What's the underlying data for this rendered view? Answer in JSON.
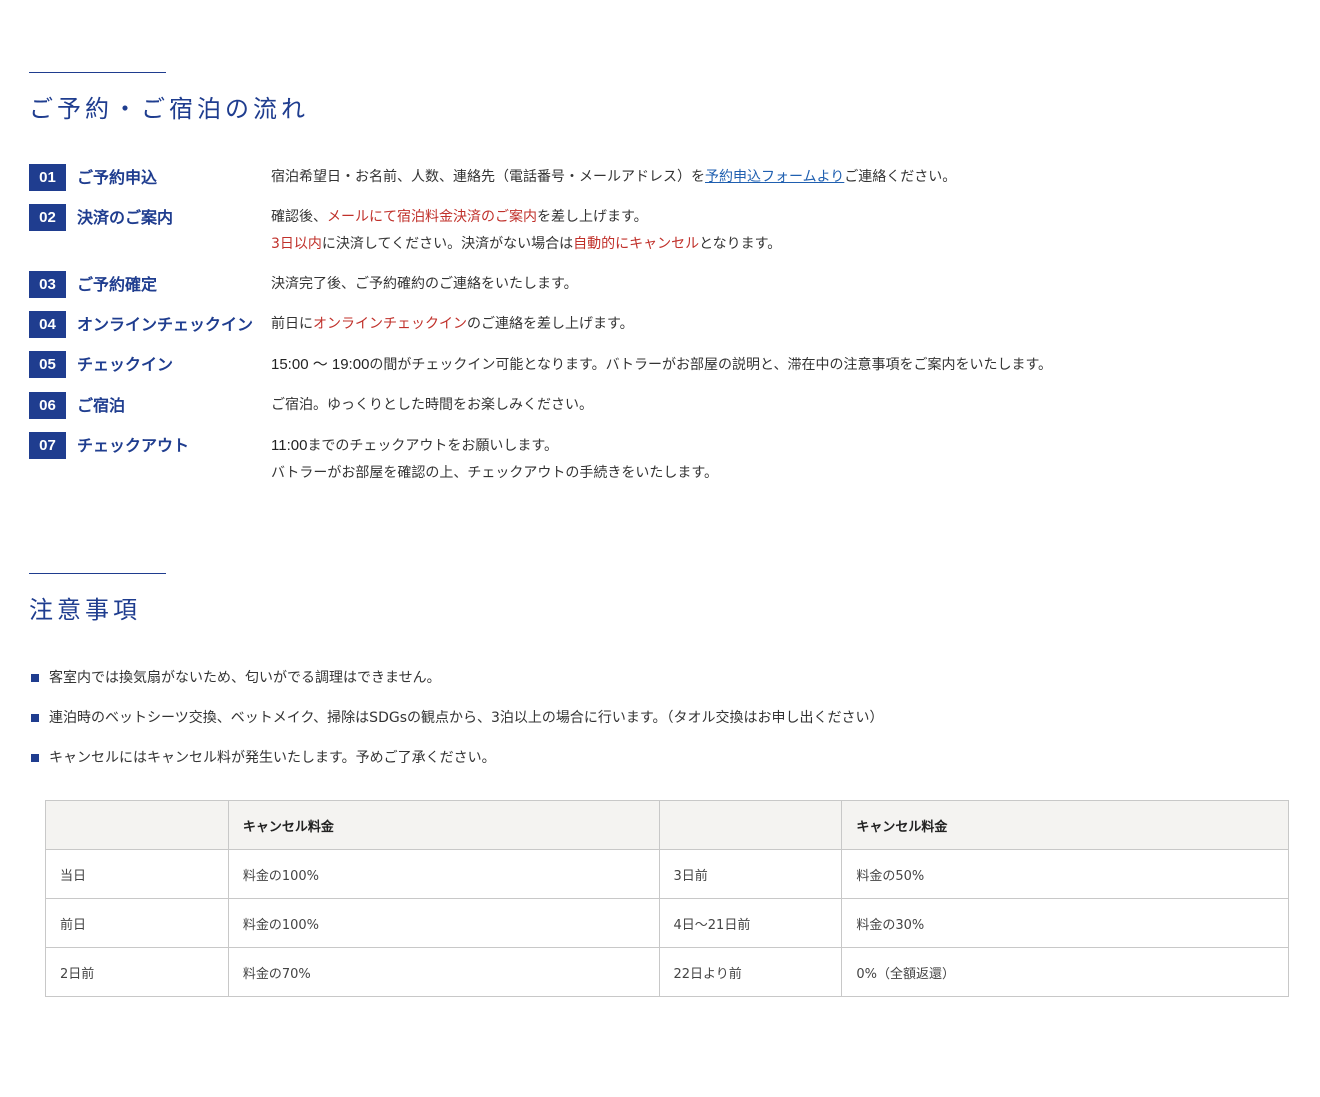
{
  "flow": {
    "title": "ご予約・ご宿泊の流れ",
    "steps": [
      {
        "num": "01",
        "title": "ご予約申込",
        "line1_a": "宿泊希望日・お名前、人数、連絡先（電話番号・メールアドレス）を",
        "line1_link": "予約申込フォームより",
        "line1_b": "ご連絡ください。"
      },
      {
        "num": "02",
        "title": "決済のご案内",
        "line1_a": "確認後、",
        "line1_red": "メールにて宿泊料金決済のご案内",
        "line1_b": "を差し上げます。",
        "line2_red1": "3日以内",
        "line2_a": "に決済してください。決済がない場合は",
        "line2_red2": "自動的にキャンセル",
        "line2_b": "となります。"
      },
      {
        "num": "03",
        "title": "ご予約確定",
        "line1": "決済完了後、ご予約確約のご連絡をいたします。"
      },
      {
        "num": "04",
        "title": "オンラインチェックイン",
        "line1_a": "前日に",
        "line1_red": "オンラインチェックイン",
        "line1_b": "のご連絡を差し上げます。"
      },
      {
        "num": "05",
        "title": "チェックイン",
        "line1_strong": "15:00 〜 19:00",
        "line1_b": "の間がチェックイン可能となります。バトラーがお部屋の説明と、滞在中の注意事項をご案内をいたします。"
      },
      {
        "num": "06",
        "title": "ご宿泊",
        "line1": "ご宿泊。ゆっくりとした時間をお楽しみください。"
      },
      {
        "num": "07",
        "title": "チェックアウト",
        "line1_strong": "11:00",
        "line1_b": "までのチェックアウトをお願いします。",
        "line2": "バトラーがお部屋を確認の上、チェックアウトの手続きをいたします。"
      }
    ]
  },
  "notes": {
    "title": "注意事項",
    "items": [
      "客室内では換気扇がないため、匂いがでる調理はできません。",
      "連泊時のベットシーツ交換、ベットメイク、掃除はSDGsの観点から、3泊以上の場合に行います。（タオル交換はお申し出ください）",
      "キャンセルにはキャンセル料が発生いたします。予めご了承ください。"
    ]
  },
  "cancel_table": {
    "headers": [
      "",
      "キャンセル料金",
      "",
      "キャンセル料金"
    ],
    "rows": [
      [
        "当日",
        "料金の100%",
        "3日前",
        "料金の50%"
      ],
      [
        "前日",
        "料金の100%",
        "4日〜21日前",
        "料金の30%"
      ],
      [
        "2日前",
        "料金の70%",
        "22日より前",
        "0%（全額返還）"
      ]
    ]
  },
  "colors": {
    "accent": "#1f3d8f",
    "highlight": "#c0302a",
    "link": "#1f5fb0"
  }
}
